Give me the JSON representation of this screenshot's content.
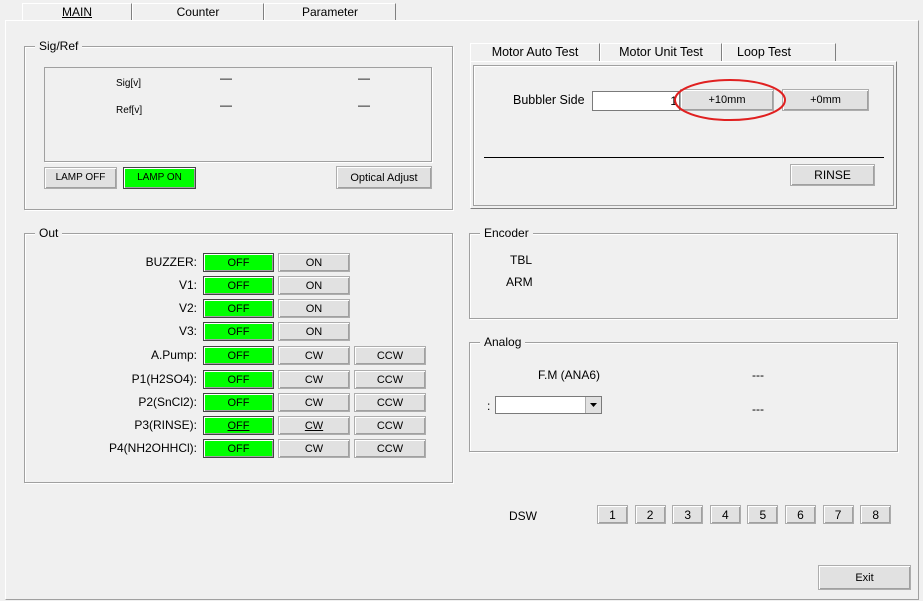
{
  "top_tabs": [
    "MAIN",
    "Counter",
    "Parameter"
  ],
  "sigref": {
    "title": "Sig/Ref",
    "sig_label": "Sig[v]",
    "ref_label": "Ref[v]",
    "sig_val1": "—",
    "sig_val2": "—",
    "ref_val1": "—",
    "ref_val2": "—",
    "lamp_off": "LAMP OFF",
    "lamp_on": "LAMP ON",
    "optical_adjust": "Optical Adjust"
  },
  "out": {
    "title": "Out",
    "rows": [
      {
        "label": "BUZZER:",
        "off": "OFF",
        "b2": "ON",
        "b3": ""
      },
      {
        "label": "V1:",
        "off": "OFF",
        "b2": "ON",
        "b3": ""
      },
      {
        "label": "V2:",
        "off": "OFF",
        "b2": "ON",
        "b3": ""
      },
      {
        "label": "V3:",
        "off": "OFF",
        "b2": "ON",
        "b3": ""
      },
      {
        "label": "A.Pump:",
        "off": "OFF",
        "b2": "CW",
        "b3": "CCW"
      },
      {
        "label": "P1(H2SO4):",
        "off": "OFF",
        "b2": "CW",
        "b3": "CCW"
      },
      {
        "label": "P2(SnCl2):",
        "off": "OFF",
        "b2": "CW",
        "b3": "CCW"
      },
      {
        "label": "P3(RINSE):",
        "off": "OFF",
        "b2": "CW",
        "b3": "CCW"
      },
      {
        "label": "P4(NH2OHHCl):",
        "off": "OFF",
        "b2": "CW",
        "b3": "CCW"
      }
    ]
  },
  "motor_tabs": [
    "Motor Auto Test",
    "Motor Unit Test",
    "Loop Test"
  ],
  "motor": {
    "bubbler_label": "Bubbler Side",
    "bubbler_value": "1",
    "plus10": "+10mm",
    "plus0": "+0mm",
    "rinse": "RINSE"
  },
  "encoder": {
    "title": "Encoder",
    "tbl": "TBL",
    "arm": "ARM"
  },
  "analog": {
    "title": "Analog",
    "fm_label": "F.M  (ANA6)",
    "fm_value": "---",
    "colon": ":",
    "combo_value": "",
    "combo_readout": "---"
  },
  "dsw": {
    "label": "DSW",
    "buttons": [
      "1",
      "2",
      "3",
      "4",
      "5",
      "6",
      "7",
      "8"
    ]
  },
  "exit_label": "Exit",
  "colors": {
    "active_green": "#00ff00",
    "highlight_circle": "#e02020"
  }
}
